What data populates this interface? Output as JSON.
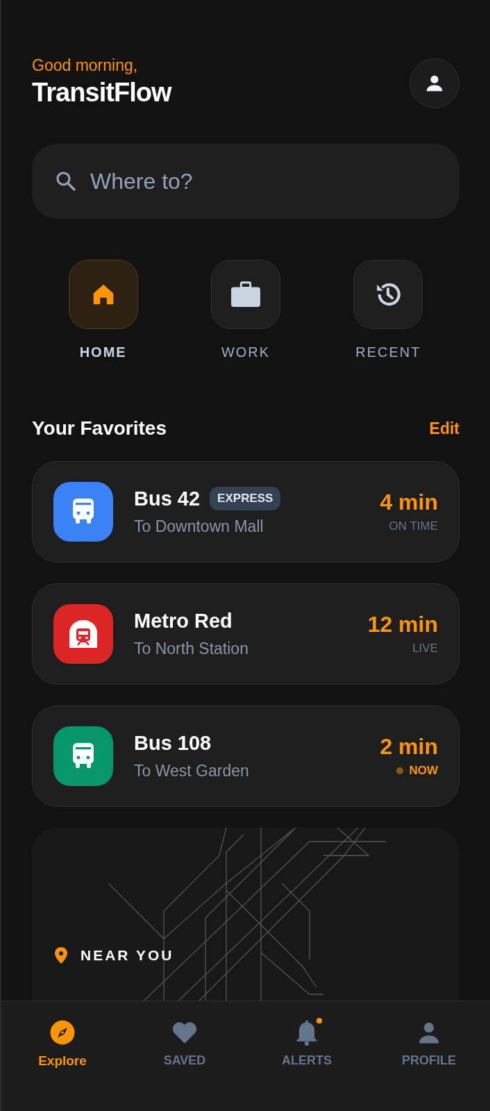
{
  "header": {
    "greeting": "Good morning,",
    "title": "TransitFlow"
  },
  "search": {
    "placeholder": "Where to?"
  },
  "quick_actions": [
    {
      "kind": "home",
      "label": "HOME",
      "selected": true
    },
    {
      "kind": "work",
      "label": "WORK",
      "selected": false
    },
    {
      "kind": "recent",
      "label": "RECENT",
      "selected": false
    }
  ],
  "favorites": {
    "title": "Your Favorites",
    "action": "Edit",
    "items": [
      {
        "kind": "bus",
        "color": "#3b82f6",
        "name": "Bus 42",
        "badge": "EXPRESS",
        "destination": "To Downtown Mall",
        "eta": "4 min",
        "status": "ON TIME",
        "highlight": false
      },
      {
        "kind": "metro",
        "color": "#dc2626",
        "name": "Metro Red",
        "destination": "To North Station",
        "eta": "12 min",
        "status": "LIVE",
        "highlight": false
      },
      {
        "kind": "bus",
        "color": "#059669",
        "name": "Bus 108",
        "destination": "To West Garden",
        "eta": "2 min",
        "status": "NOW",
        "highlight": true
      }
    ]
  },
  "near_you": {
    "label": "NEAR YOU"
  },
  "nav": [
    {
      "kind": "explore",
      "label": "Explore",
      "selected": true,
      "notification": false
    },
    {
      "kind": "saved",
      "label": "SAVED",
      "selected": false,
      "notification": false
    },
    {
      "kind": "alerts",
      "label": "ALERTS",
      "selected": false,
      "notification": true
    },
    {
      "kind": "profile",
      "label": "PROFILE",
      "selected": false,
      "notification": false
    }
  ]
}
